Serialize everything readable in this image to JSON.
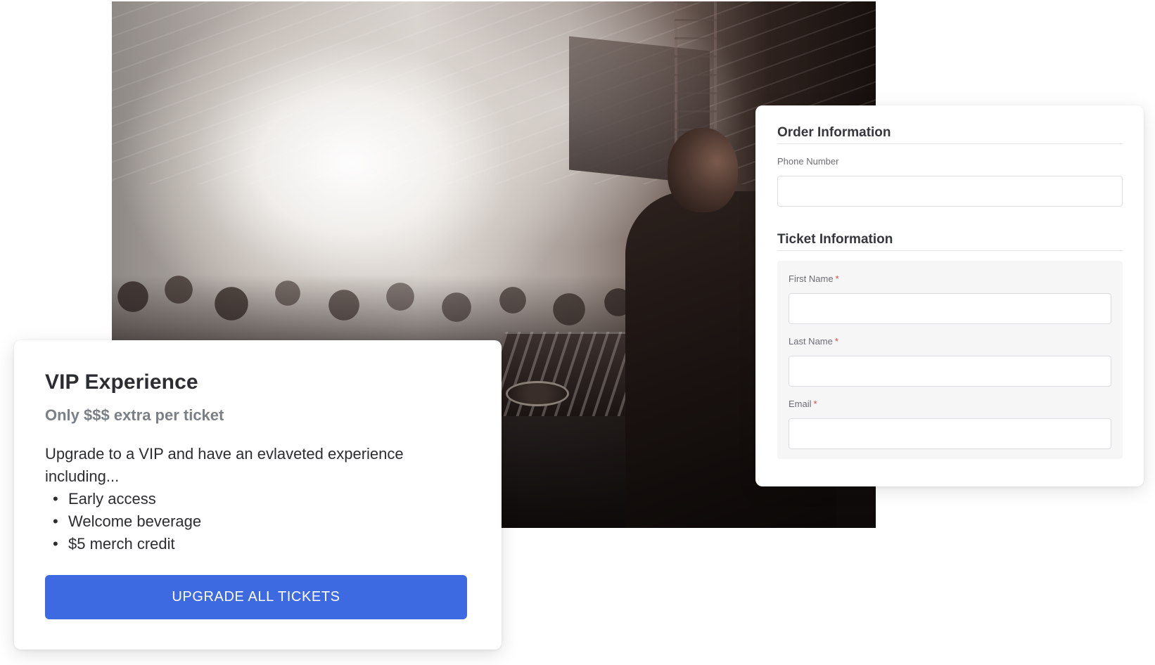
{
  "hero_image": {
    "description_icon": "concert-dj-photo"
  },
  "vip": {
    "title": "VIP Experience",
    "subtitle": "Only $$$ extra per ticket",
    "description": "Upgrade to a VIP and have an evlaveted experience including...",
    "perks": [
      "Early access",
      "Welcome beverage",
      "$5 merch credit"
    ],
    "bullet": "•",
    "button_label": "UPGRADE ALL TICKETS"
  },
  "order_form": {
    "order_section_title": "Order Information",
    "phone_label": "Phone Number",
    "phone_value": "",
    "ticket_section_title": "Ticket Information",
    "required_marker": "*",
    "first_name_label": "First Name",
    "first_name_value": "",
    "last_name_label": "Last Name",
    "last_name_value": "",
    "email_label": "Email",
    "email_value": ""
  },
  "colors": {
    "button_blue": "#3e6ae1",
    "required_red": "#e04545",
    "subtitle_gray": "#7b7f86",
    "text_dark": "#2b2d31"
  }
}
